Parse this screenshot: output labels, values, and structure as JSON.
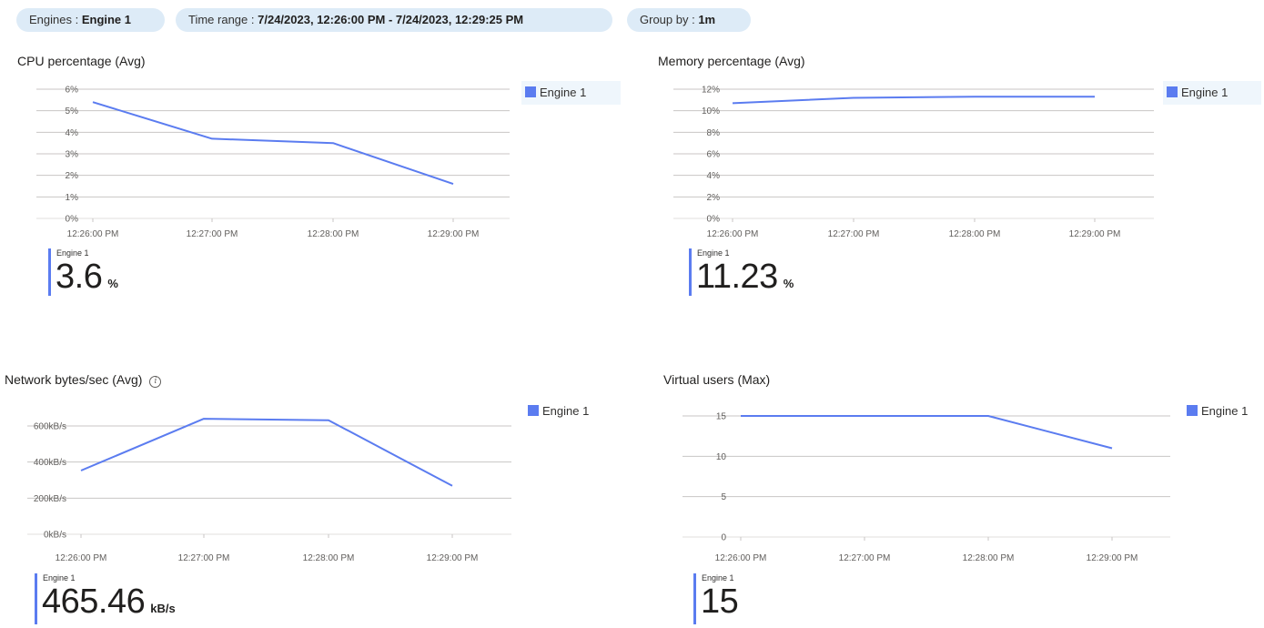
{
  "filters": {
    "engines": {
      "label": "Engines :",
      "value": "Engine 1"
    },
    "time_range": {
      "label": "Time range :",
      "value": "7/24/2023, 12:26:00 PM - 7/24/2023, 12:29:25 PM"
    },
    "group_by": {
      "label": "Group by :",
      "value": "1m"
    }
  },
  "accent_color": "#5b7cf0",
  "charts": {
    "cpu": {
      "title": "CPU percentage (Avg)",
      "legend": "Engine 1",
      "summary_name": "Engine 1",
      "summary_value": "3.6",
      "summary_unit": "%"
    },
    "memory": {
      "title": "Memory percentage (Avg)",
      "legend": "Engine 1",
      "summary_name": "Engine 1",
      "summary_value": "11.23",
      "summary_unit": "%"
    },
    "network": {
      "title": "Network bytes/sec (Avg)",
      "legend": "Engine 1",
      "summary_name": "Engine 1",
      "summary_value": "465.46",
      "summary_unit": "kB/s"
    },
    "vusers": {
      "title": "Virtual users (Max)",
      "legend": "Engine 1",
      "summary_name": "Engine 1",
      "summary_value": "15",
      "summary_unit": ""
    }
  },
  "chart_data": [
    {
      "type": "line",
      "title": "CPU percentage (Avg)",
      "x": [
        "12:26:00 PM",
        "12:27:00 PM",
        "12:28:00 PM",
        "12:29:00 PM"
      ],
      "yticks": [
        "0%",
        "1%",
        "2%",
        "3%",
        "4%",
        "5%",
        "6%"
      ],
      "ylim": [
        0,
        6
      ],
      "series": [
        {
          "name": "Engine 1",
          "values": [
            5.4,
            3.7,
            3.5,
            1.6
          ]
        }
      ],
      "grid": true,
      "legend": "right"
    },
    {
      "type": "line",
      "title": "Memory percentage (Avg)",
      "x": [
        "12:26:00 PM",
        "12:27:00 PM",
        "12:28:00 PM",
        "12:29:00 PM"
      ],
      "yticks": [
        "0%",
        "2%",
        "4%",
        "6%",
        "8%",
        "10%",
        "12%"
      ],
      "ylim": [
        0,
        12
      ],
      "series": [
        {
          "name": "Engine 1",
          "values": [
            10.7,
            11.2,
            11.3,
            11.3
          ]
        }
      ],
      "grid": true,
      "legend": "right"
    },
    {
      "type": "line",
      "title": "Network bytes/sec (Avg)",
      "x": [
        "12:26:00 PM",
        "12:27:00 PM",
        "12:28:00 PM",
        "12:29:00 PM"
      ],
      "yticks": [
        "0kB/s",
        "200kB/s",
        "400kB/s",
        "600kB/s"
      ],
      "ylim": [
        0,
        600
      ],
      "series": [
        {
          "name": "Engine 1",
          "values": [
            353,
            640,
            632,
            268
          ]
        }
      ],
      "grid": true,
      "legend": "right"
    },
    {
      "type": "line",
      "title": "Virtual users (Max)",
      "x": [
        "12:26:00 PM",
        "12:27:00 PM",
        "12:28:00 PM",
        "12:29:00 PM"
      ],
      "yticks": [
        "0",
        "5",
        "10",
        "15"
      ],
      "ylim": [
        0,
        15
      ],
      "series": [
        {
          "name": "Engine 1",
          "values": [
            15,
            15,
            15,
            11
          ]
        }
      ],
      "grid": true,
      "legend": "right"
    }
  ]
}
